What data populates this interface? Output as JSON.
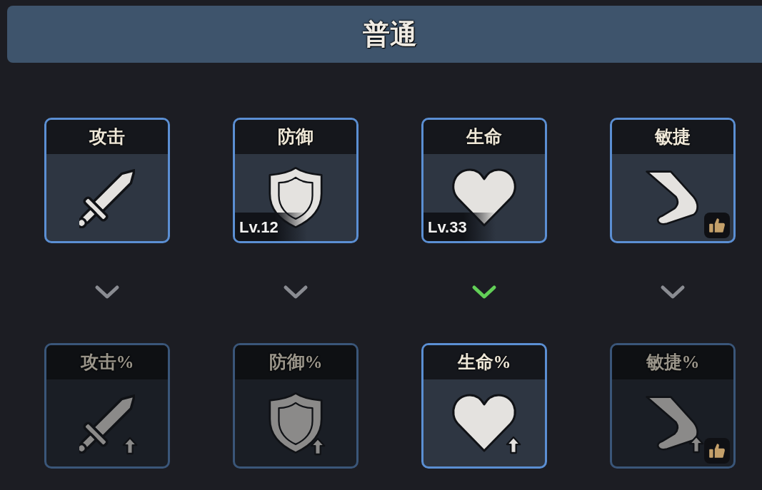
{
  "header": {
    "title": "普通"
  },
  "top_row": [
    {
      "label": "攻击",
      "kind": "sword",
      "unlocked": true,
      "boosted": false,
      "recommended": false
    },
    {
      "label": "防御",
      "kind": "shield",
      "rank": "Lv.12",
      "unlocked": true,
      "boosted": false,
      "recommended": false
    },
    {
      "label": "生命",
      "kind": "heart",
      "rank": "Lv.33",
      "unlocked": true,
      "boosted": false,
      "recommended": false
    },
    {
      "label": "敏捷",
      "kind": "boot",
      "unlocked": true,
      "boosted": false,
      "recommended": true
    }
  ],
  "links": [
    {
      "active": false
    },
    {
      "active": false
    },
    {
      "active": true
    },
    {
      "active": false
    }
  ],
  "bottom_row": [
    {
      "label": "攻击%",
      "kind": "sword",
      "unlocked": false,
      "boosted": true,
      "recommended": false
    },
    {
      "label": "防御%",
      "kind": "shield",
      "unlocked": false,
      "boosted": true,
      "recommended": false
    },
    {
      "label": "生命%",
      "kind": "heart",
      "unlocked": true,
      "boosted": true,
      "recommended": false
    },
    {
      "label": "敏捷%",
      "kind": "boot",
      "unlocked": false,
      "boosted": true,
      "recommended": true
    }
  ]
}
